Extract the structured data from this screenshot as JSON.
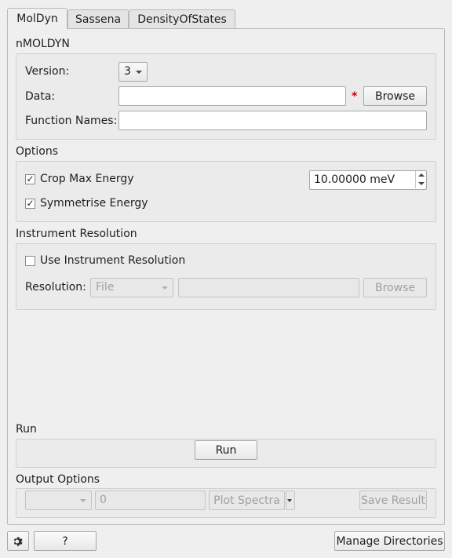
{
  "tabs": [
    {
      "label": "MolDyn",
      "active": true
    },
    {
      "label": "Sassena",
      "active": false
    },
    {
      "label": "DensityOfStates",
      "active": false
    }
  ],
  "nmoldyn": {
    "title": "nMOLDYN",
    "version_label": "Version:",
    "version_value": "3",
    "data_label": "Data:",
    "data_value": "",
    "required_marker": "*",
    "browse_label": "Browse",
    "function_names_label": "Function Names:",
    "function_names_value": ""
  },
  "options": {
    "title": "Options",
    "crop_label": "Crop Max Energy",
    "crop_checked": true,
    "crop_value": "10.00000 meV",
    "symmetrise_label": "Symmetrise Energy",
    "symmetrise_checked": true
  },
  "instrument": {
    "title": "Instrument Resolution",
    "use_label": "Use Instrument Resolution",
    "use_checked": false,
    "resolution_label": "Resolution:",
    "resolution_option": "File",
    "resolution_value": "",
    "browse_label": "Browse"
  },
  "run": {
    "title": "Run",
    "run_label": "Run"
  },
  "output": {
    "title": "Output Options",
    "workspace_option": "",
    "index_value": "0",
    "plot_label": "Plot Spectra",
    "save_label": "Save Result"
  },
  "bottom": {
    "settings_icon": "gear-icon",
    "help_label": "?",
    "manage_label": "Manage Directories"
  },
  "colors": {
    "required": "#cc0000",
    "background": "#efefef"
  }
}
